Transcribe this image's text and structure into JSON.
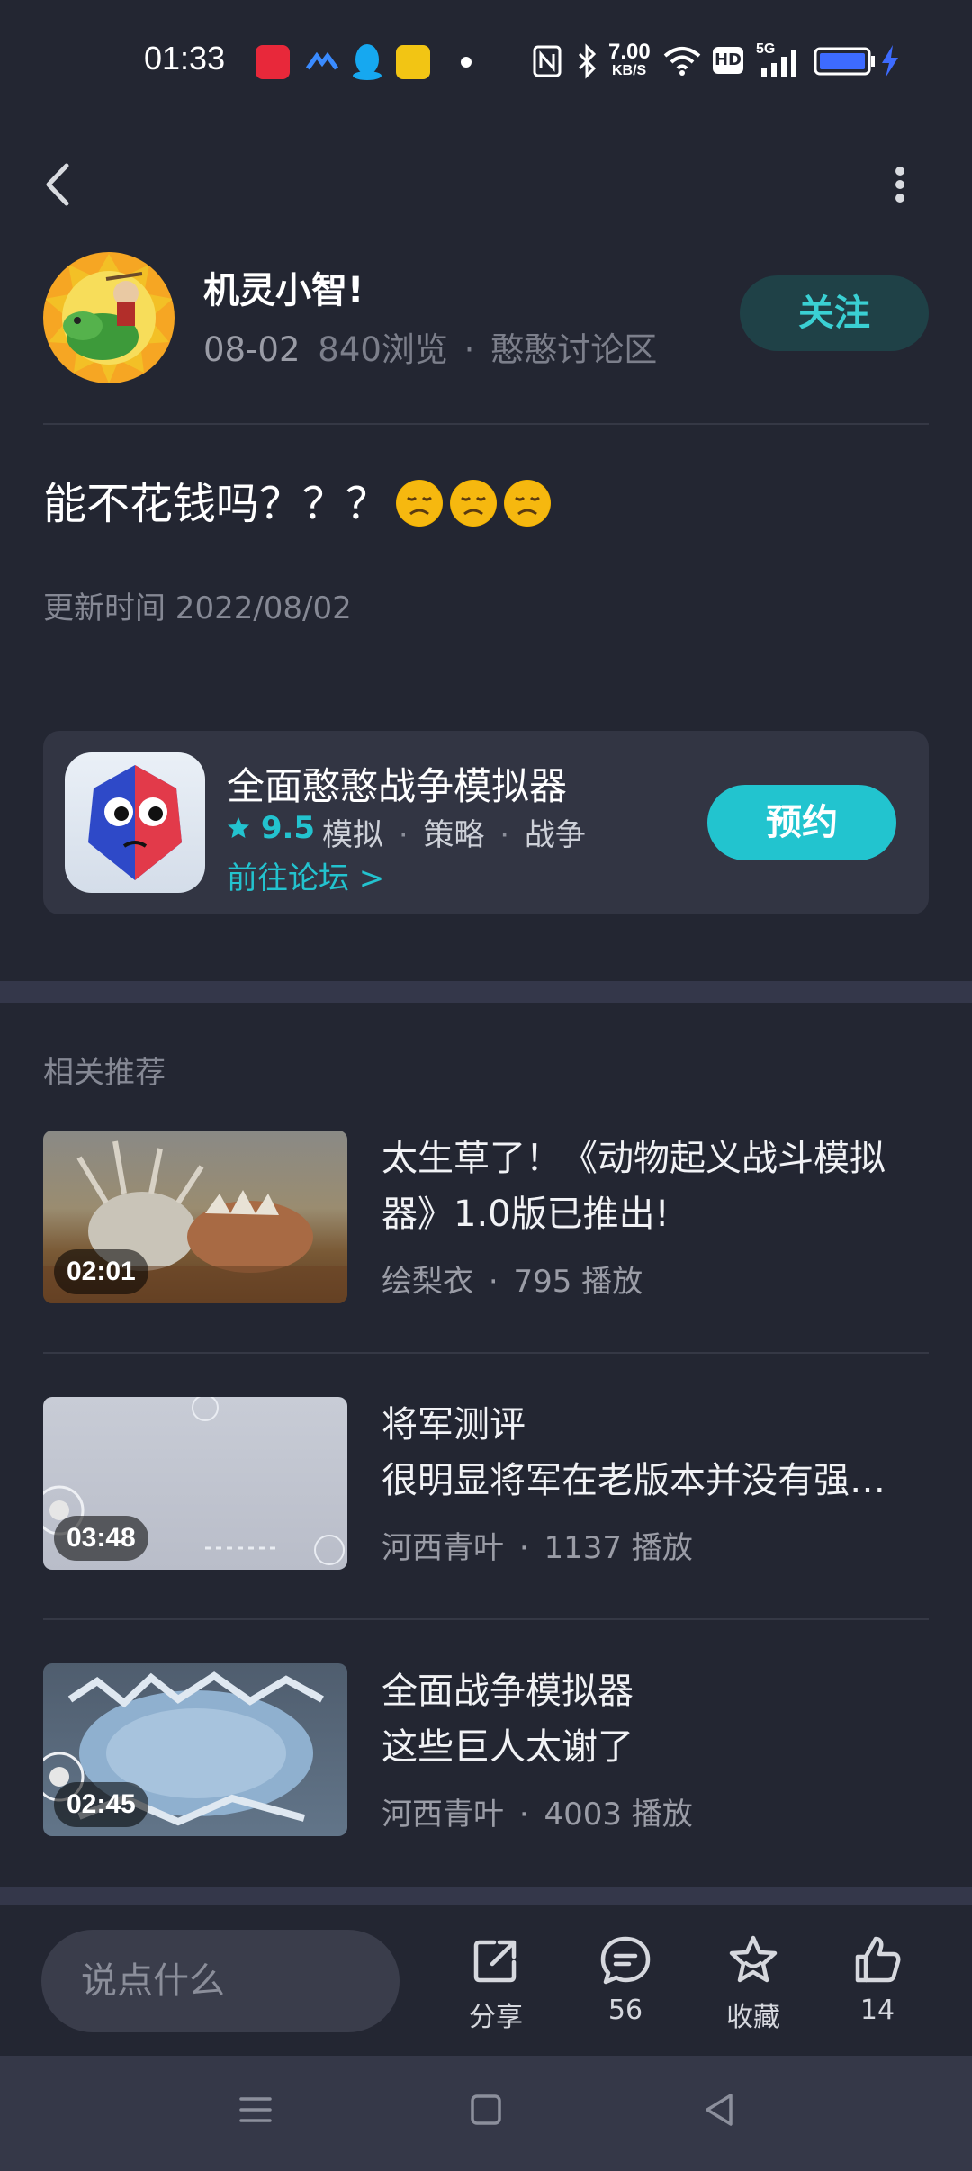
{
  "status_bar": {
    "time": "01:33",
    "network_speed_value": "7.00",
    "network_speed_unit": "KB/S",
    "hd_label": "HD",
    "signal_label": "5G"
  },
  "nav": {
    "back_icon": "chevron-left-icon",
    "more_icon": "more-vertical-icon"
  },
  "post": {
    "author": "机灵小智!",
    "date": "08-02",
    "views": "840浏览",
    "forum": "憨憨讨论区",
    "follow_label": "关注",
    "title": "能不花钱吗？？？",
    "update_time": "更新时间 2022/08/02"
  },
  "game_card": {
    "name": "全面憨憨战争模拟器",
    "rating": "9.5",
    "tags": [
      "模拟",
      "策略",
      "战争"
    ],
    "forum_link": "前往论坛 >",
    "reserve_label": "预约"
  },
  "recommendations": {
    "section_title": "相关推荐",
    "items": [
      {
        "title_line1": "太生草了！《动物起义战斗模拟",
        "title_line2": "器》1.0版已推出!",
        "author": "绘梨衣",
        "plays": "795 播放",
        "duration": "02:01"
      },
      {
        "title_line1": "将军测评",
        "title_line2": "很明显将军在老版本并没有强…",
        "author": "河西青叶",
        "plays": "1137 播放",
        "duration": "03:48"
      },
      {
        "title_line1": "全面战争模拟器",
        "title_line2": "这些巨人太谢了",
        "author": "河西青叶",
        "plays": "4003 播放",
        "duration": "02:45"
      }
    ]
  },
  "action_bar": {
    "comment_placeholder": "说点什么",
    "share_label": "分享",
    "comments_count": "56",
    "favorite_label": "收藏",
    "likes_count": "14"
  },
  "colors": {
    "background": "#232632",
    "accent": "#22c4cf",
    "card": "#323543"
  }
}
